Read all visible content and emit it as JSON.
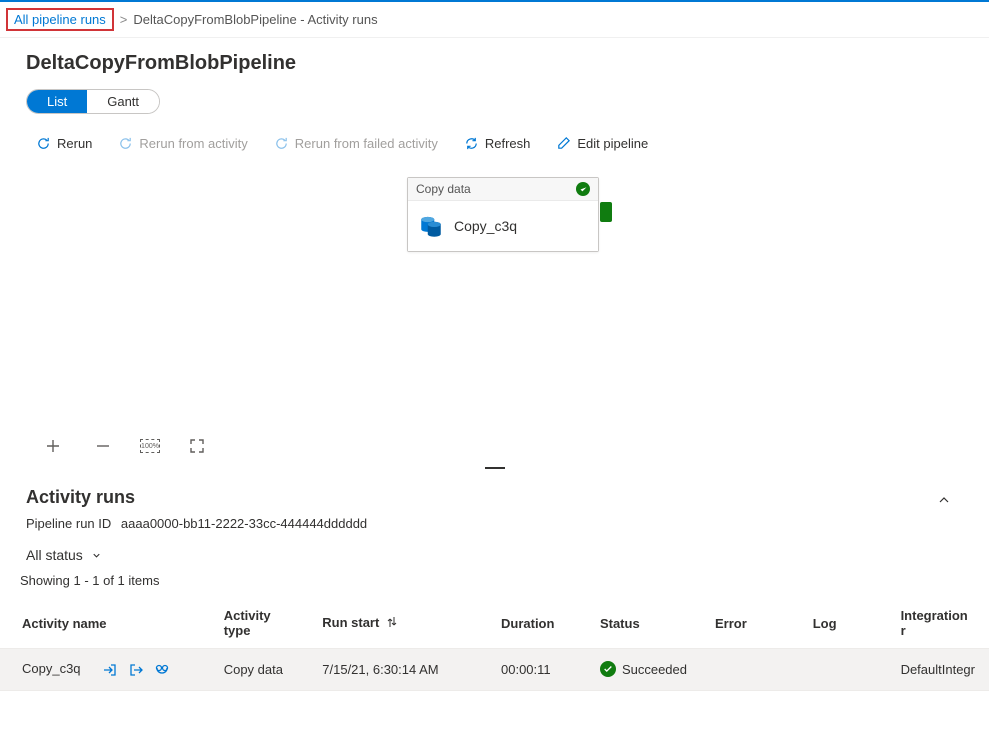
{
  "breadcrumb": {
    "link": "All pipeline runs",
    "current": "DeltaCopyFromBlobPipeline - Activity runs"
  },
  "header": {
    "title": "DeltaCopyFromBlobPipeline"
  },
  "viewToggle": {
    "list": "List",
    "gantt": "Gantt"
  },
  "toolbar": {
    "rerun": "Rerun",
    "rerunFromActivity": "Rerun from activity",
    "rerunFromFailed": "Rerun from failed activity",
    "refresh": "Refresh",
    "editPipeline": "Edit pipeline"
  },
  "activityNode": {
    "type": "Copy data",
    "name": "Copy_c3q"
  },
  "activityRuns": {
    "title": "Activity runs",
    "runIdLabel": "Pipeline run ID",
    "runId": "aaaa0000-bb11-2222-33cc-444444dddddd",
    "filter": "All status",
    "showing": "Showing 1 - 1 of 1 items",
    "columns": {
      "activityName": "Activity name",
      "activityType": "Activity type",
      "runStart": "Run start",
      "duration": "Duration",
      "status": "Status",
      "error": "Error",
      "log": "Log",
      "integration": "Integration r"
    },
    "rows": [
      {
        "activityName": "Copy_c3q",
        "activityType": "Copy data",
        "runStart": "7/15/21, 6:30:14 AM",
        "duration": "00:00:11",
        "status": "Succeeded",
        "error": "",
        "log": "",
        "integration": "DefaultIntegr"
      }
    ]
  }
}
